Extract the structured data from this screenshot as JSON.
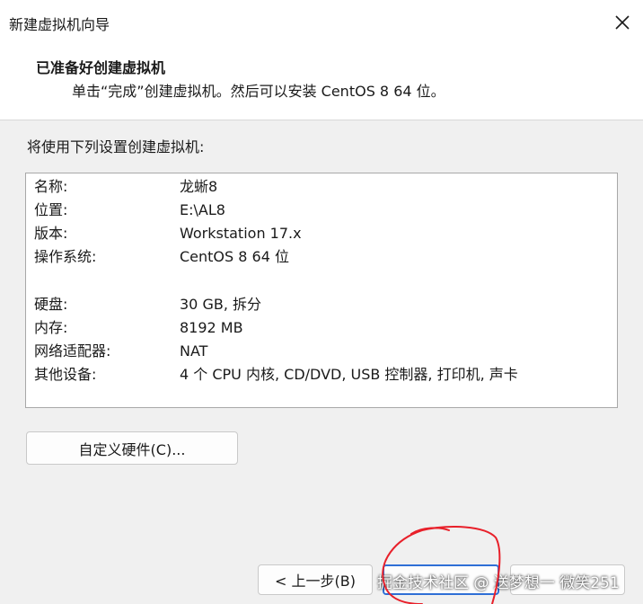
{
  "window": {
    "title": "新建虚拟机向导",
    "close_icon": "close-icon"
  },
  "header": {
    "title": "已准备好创建虚拟机",
    "subtitle": "单击“完成”创建虚拟机。然后可以安装 CentOS 8 64 位。"
  },
  "main": {
    "intro": "将使用下列设置创建虚拟机:",
    "settings": [
      {
        "label": "名称:",
        "value": "龙蜥8"
      },
      {
        "label": "位置:",
        "value": "E:\\AL8"
      },
      {
        "label": "版本:",
        "value": "Workstation 17.x"
      },
      {
        "label": "操作系统:",
        "value": "CentOS 8 64 位"
      },
      {
        "label": "硬盘:",
        "value": "30 GB, 拆分"
      },
      {
        "label": "内存:",
        "value": "8192 MB"
      },
      {
        "label": "网络适配器:",
        "value": "NAT"
      },
      {
        "label": "其他设备:",
        "value": "4 个 CPU 内核, CD/DVD, USB 控制器, 打印机, 声卡"
      }
    ],
    "customize_label": "自定义硬件(C)..."
  },
  "footer": {
    "back_label": "< 上一步(B)",
    "finish_label": "",
    "cancel_label": ""
  },
  "watermark": "掘金技术社区 @ 送梦想一 微笑251",
  "colors": {
    "annotation": "#e8202a",
    "focus_border": "#2f6fd6"
  }
}
